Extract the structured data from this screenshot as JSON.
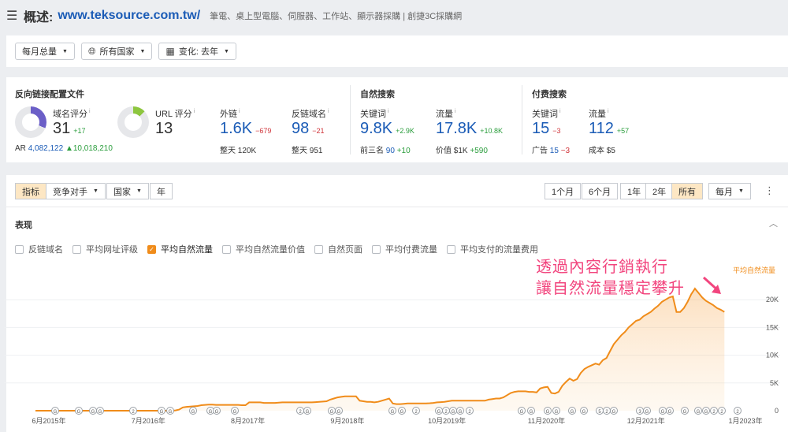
{
  "header": {
    "menu_icon": "hamburger-icon",
    "label": "概述:",
    "url": "www.teksource.com.tw/",
    "description": "筆電、桌上型電腦、伺服器、工作站、顯示器採購 | 創捷3C採購網"
  },
  "filters": {
    "period": "每月总量",
    "country": "所有国家",
    "compare": "变化: 去年",
    "globe_icon": "globe-icon",
    "calendar_icon": "calendar-icon"
  },
  "metrics": {
    "backlink_title": "反向链接配置文件",
    "domain_rating": {
      "label": "域名评分",
      "value": "31",
      "delta": "+17",
      "fill": 0.31,
      "color": "#6b5fc7"
    },
    "ar": {
      "label": "AR",
      "value": "4,082,122",
      "delta": "10,018,210"
    },
    "url_rating": {
      "label": "URL 评分",
      "value": "13",
      "fill": 0.13,
      "color": "#8dc63f"
    },
    "external": {
      "label": "外链",
      "value": "1.6K",
      "delta": "−679",
      "sub_label": "整天",
      "sub_value": "120K"
    },
    "refdomains": {
      "label": "反链域名",
      "value": "98",
      "delta": "−21",
      "sub_label": "整天",
      "sub_value": "951"
    },
    "organic_title": "自然搜索",
    "org_keywords": {
      "label": "关键词",
      "value": "9.8K",
      "delta": "+2.9K",
      "sub_label": "前三名",
      "sub_value": "90",
      "sub_delta": "+10"
    },
    "org_traffic": {
      "label": "流量",
      "value": "17.8K",
      "delta": "+10.8K",
      "sub_label": "价值",
      "sub_value": "$1K",
      "sub_delta": "+590"
    },
    "paid_title": "付费搜索",
    "paid_keywords": {
      "label": "关键词",
      "value": "15",
      "delta": "−3",
      "sub_label": "广告",
      "sub_value": "15",
      "sub_delta": "−3"
    },
    "paid_traffic": {
      "label": "流量",
      "value": "112",
      "delta": "+57",
      "sub_label": "成本",
      "sub_value": "$5"
    }
  },
  "tabs": {
    "left": [
      "指标",
      "竞争对手",
      "国家",
      "年"
    ],
    "range": [
      "1个月",
      "6个月",
      "1年",
      "2年",
      "所有"
    ],
    "interval": "每月",
    "more_icon": "more-vertical-icon"
  },
  "panel": {
    "section_label": "表现",
    "collapse_icon": "chevron-up-icon",
    "legend": [
      {
        "label": "反链域名",
        "checked": false
      },
      {
        "label": "平均网址评级",
        "checked": false
      },
      {
        "label": "平均自然流量",
        "checked": true
      },
      {
        "label": "平均自然流量价值",
        "checked": false
      },
      {
        "label": "自然页面",
        "checked": false
      },
      {
        "label": "平均付费流量",
        "checked": false
      },
      {
        "label": "平均支付的流量费用",
        "checked": false
      }
    ],
    "annotation_line1": "透過內容行銷執行",
    "annotation_line2": "讓自然流量穩定攀升"
  },
  "chart_data": {
    "type": "area",
    "series": [
      {
        "name": "平均自然流量",
        "color": "#f08c1a",
        "values": [
          0,
          0,
          0,
          0,
          0,
          0,
          0,
          0,
          0,
          0,
          0,
          0,
          0,
          0,
          0,
          0,
          0,
          0,
          0,
          0,
          0,
          0,
          0,
          0,
          0,
          0,
          0,
          0,
          0,
          0,
          0,
          0,
          0,
          0,
          0,
          0,
          0,
          0,
          50,
          200,
          600,
          700,
          750,
          800,
          850,
          1000,
          1050,
          1100,
          1100,
          1050,
          1050,
          1050,
          1050,
          1050,
          1050,
          1050,
          1000,
          1000,
          1500,
          1500,
          1500,
          1500,
          1400,
          1400,
          1400,
          1400,
          1450,
          1500,
          1500,
          1500,
          1500,
          1500,
          1500,
          1500,
          1500,
          1500,
          1550,
          1600,
          1650,
          1700,
          2000,
          2200,
          2400,
          2500,
          2600,
          2600,
          2600,
          2600,
          1800,
          1700,
          1600,
          1600,
          1500,
          1600,
          1800,
          2000,
          2200,
          1300,
          1200,
          1200,
          1250,
          1300,
          1300,
          1300,
          1300,
          1300,
          1300,
          1350,
          1400,
          1500,
          1550,
          1600,
          1700,
          1800,
          1800,
          1800,
          1800,
          1800,
          1800,
          1800,
          1800,
          1800,
          1800,
          2000,
          2100,
          2200,
          2200,
          2400,
          2800,
          3200,
          3400,
          3500,
          3500,
          3500,
          3400,
          3400,
          3300,
          4000,
          4200,
          4300,
          3200,
          3100,
          3400,
          4500,
          5200,
          5800,
          5400,
          5700,
          6800,
          7500,
          7900,
          8200,
          8500,
          8300,
          9100,
          9500,
          10800,
          12000,
          12800,
          13600,
          14200,
          15000,
          15600,
          16200,
          16400,
          17000,
          17400,
          17800,
          18400,
          18900,
          19600,
          20000,
          20400,
          20600,
          17800,
          17800,
          18500,
          19600,
          21000,
          22000,
          21200,
          20400,
          19800,
          19400,
          19000,
          18500,
          18200,
          17800
        ]
      }
    ],
    "x_labels": [
      "6月2015年",
      "7月2016年",
      "8月2017年",
      "9月2018年",
      "10月2019年",
      "11月2020年",
      "12月2021年",
      "1月2023年"
    ],
    "y_labels": [
      "20K",
      "15K",
      "10K",
      "5K",
      "0"
    ],
    "y_ticks": [
      20000,
      15000,
      10000,
      5000,
      0
    ],
    "ylim": [
      0,
      25000
    ],
    "x_range": [
      0,
      191
    ],
    "event_marker_labels": [
      "2",
      "2",
      "2",
      "2",
      "2",
      "2",
      "2",
      "2",
      "5",
      "3",
      "2"
    ],
    "grid": true
  }
}
